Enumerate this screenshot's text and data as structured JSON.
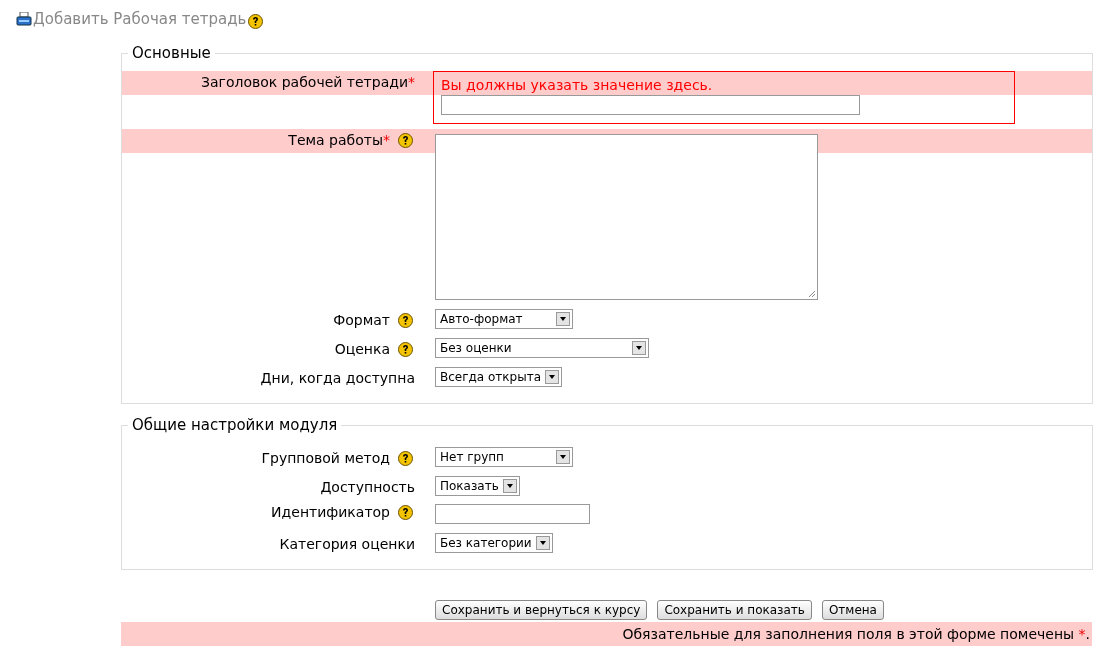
{
  "page_title": "Добавить Рабочая тетрадь",
  "page_help": true,
  "fieldsets": [
    {
      "legend": "Основные",
      "fields": [
        {
          "kind": "text",
          "label": "Заголовок рабочей тетради",
          "required_mark": "*",
          "help": false,
          "error": "Вы должны указать значение здесь."
        },
        {
          "kind": "textarea",
          "label": "Тема работы",
          "required_mark": "*",
          "help": true
        },
        {
          "kind": "select",
          "label": "Формат",
          "help": true,
          "value": "Авто-формат"
        },
        {
          "kind": "select",
          "label": "Оценка",
          "help": true,
          "value": "Без оценки"
        },
        {
          "kind": "select",
          "label": "Дни, когда доступна",
          "help": false,
          "value": "Всегда открыта"
        }
      ]
    },
    {
      "legend": "Общие настройки модуля",
      "fields": [
        {
          "kind": "select",
          "label": "Групповой метод",
          "help": true,
          "value": "Нет групп"
        },
        {
          "kind": "select",
          "label": "Доступность",
          "help": false,
          "value": "Показать"
        },
        {
          "kind": "text",
          "label": "Идентификатор",
          "help": true
        },
        {
          "kind": "select",
          "label": "Категория оценки",
          "help": false,
          "value": "Без категории"
        }
      ]
    }
  ],
  "buttons": [
    "Сохранить и вернуться к курсу",
    "Сохранить и показать",
    "Отмена"
  ],
  "footer": {
    "text": "Обязательные для заполнения поля в этой форме помечены ",
    "mark": "*",
    "end": "."
  }
}
